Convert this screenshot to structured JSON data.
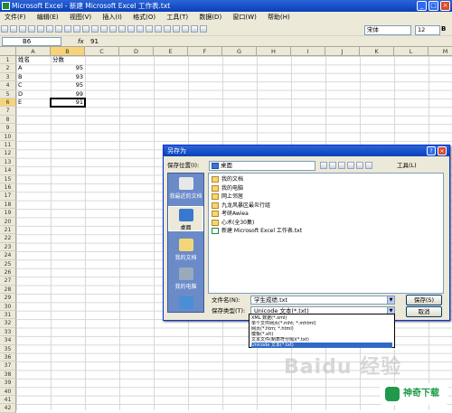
{
  "window": {
    "title": "Microsoft Excel - 新建 Microsoft Excel 工作表.txt"
  },
  "menu": [
    "文件(F)",
    "编辑(E)",
    "视图(V)",
    "插入(I)",
    "格式(O)",
    "工具(T)",
    "数据(D)",
    "窗口(W)",
    "帮助(H)"
  ],
  "toolbar": {
    "font": "宋体",
    "size": "12",
    "bold": "B",
    "italic": "I",
    "underline": "U",
    "sum": "Σ"
  },
  "formula": {
    "namebox": "B6",
    "fx": "fx",
    "value": "91"
  },
  "columns": [
    "A",
    "B",
    "C",
    "D",
    "E",
    "F",
    "G",
    "H",
    "I",
    "J",
    "K",
    "L",
    "M"
  ],
  "rows": [
    "1",
    "2",
    "3",
    "4",
    "5",
    "6",
    "7",
    "8",
    "9",
    "10",
    "11",
    "12",
    "13",
    "14",
    "15",
    "16",
    "17",
    "18",
    "19",
    "20",
    "21",
    "22",
    "23",
    "24",
    "25",
    "26",
    "27",
    "28",
    "29",
    "30",
    "31",
    "32",
    "33",
    "34",
    "35",
    "36",
    "37",
    "38",
    "39",
    "40",
    "41",
    "42"
  ],
  "sheet": {
    "header": [
      "姓名",
      "分数"
    ],
    "data": [
      [
        "A",
        "95"
      ],
      [
        "B",
        "93"
      ],
      [
        "C",
        "95"
      ],
      [
        "D",
        "99"
      ],
      [
        "E",
        "91"
      ]
    ]
  },
  "dialog": {
    "title": "另存为",
    "location_label": "保存位置(I):",
    "location": "桌面",
    "tools_label": "工具(L)",
    "places": [
      "我最近的文档",
      "桌面",
      "我的文档",
      "我的电脑",
      "网上邻居"
    ],
    "files": [
      "我的文档",
      "我的电脑",
      "网上邻居",
      "九龙风暴区最炎行组",
      "考研Awiea",
      "心术(全30集)",
      "新建 Microsoft Excel 工作表.txt"
    ],
    "filename_label": "文件名(N):",
    "filename": "学生成绩.txt",
    "filetype_label": "保存类型(T):",
    "filetype": "Unicode 文本(*.txt)",
    "save_button": "保存(S)",
    "cancel_button": "取消",
    "type_options": [
      "XML 数据(*.xml)",
      "单个文件网页(*.mht; *.mhtml)",
      "网页(*.htm; *.html)",
      "模板(*.xlt)",
      "文本文件(制表符分隔)(*.txt)",
      "Unicode 文本(*.txt)"
    ]
  },
  "watermark": "Baidu 经验",
  "brand": "神奇下载"
}
